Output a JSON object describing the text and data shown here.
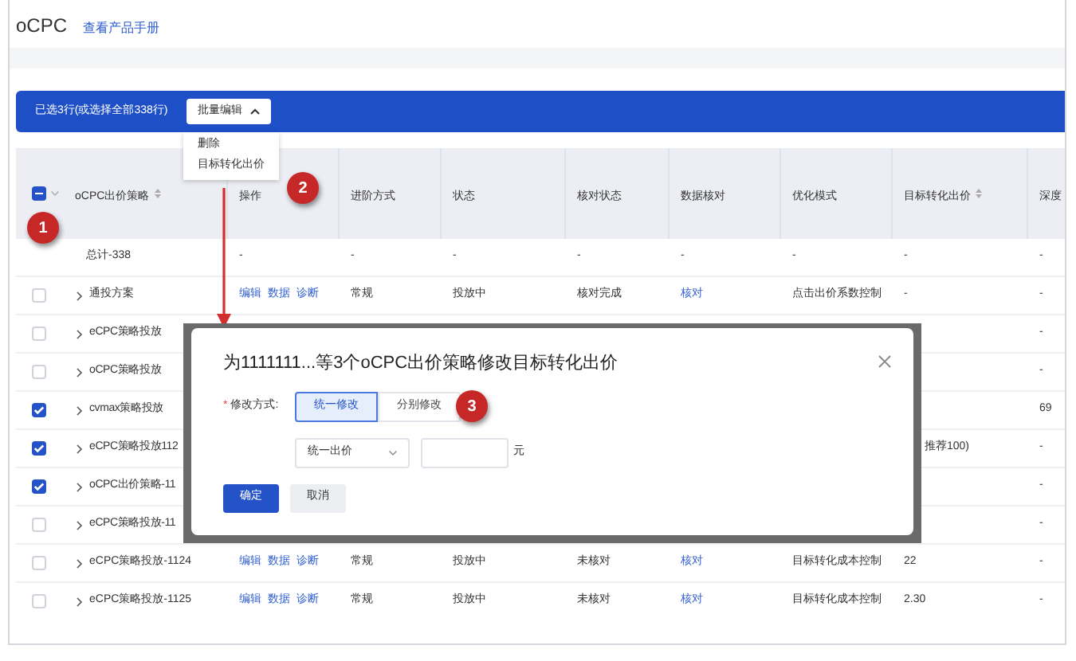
{
  "header": {
    "title": "oCPC",
    "link": "查看产品手册"
  },
  "selection_bar": {
    "text": "已选3行(或选择全部338行)",
    "button": "批量编辑",
    "menu_open": true
  },
  "menu": [
    "删除",
    "目标转化出价"
  ],
  "table": {
    "header_indeterminate": true,
    "columns": [
      "oCPC出价策略",
      "操作",
      "进阶方式",
      "状态",
      "核对状态",
      "数据核对",
      "优化模式",
      "目标转化出价",
      "深度"
    ],
    "rows": [
      {
        "kind": "total",
        "name": "总计-338",
        "cells": [
          "-",
          "-",
          "-",
          "-",
          "-",
          "-",
          "-",
          "-"
        ]
      },
      {
        "kind": "row",
        "name": "通投方案",
        "checked": false,
        "actions": [
          "编辑",
          "数据",
          "诊断"
        ],
        "mode": "常规",
        "status": "投放中",
        "check_status": "核对完成",
        "data_check": "核对",
        "opt_mode": "点击出价系数控制",
        "target": "-",
        "deep": "-"
      },
      {
        "kind": "covered",
        "name": "eCPC策略投放",
        "checked": false,
        "deep": "-"
      },
      {
        "kind": "covered",
        "name": "oCPC策略投放",
        "checked": false,
        "deep": "-"
      },
      {
        "kind": "covered",
        "name": "cvmax策略投放",
        "checked": true,
        "deep": "69"
      },
      {
        "kind": "covered",
        "name": "eCPC策略投放112",
        "checked": true,
        "target": "推荐100)",
        "deep": "-"
      },
      {
        "kind": "covered",
        "name": "oCPC出价策略-11",
        "checked": true,
        "deep": "-"
      },
      {
        "kind": "covered",
        "name": "eCPC策略投放-11",
        "checked": false,
        "deep": "-"
      },
      {
        "kind": "row",
        "name": "eCPC策略投放-1124",
        "checked": false,
        "actions": [
          "编辑",
          "数据",
          "诊断"
        ],
        "mode": "常规",
        "status": "投放中",
        "check_status": "未核对",
        "data_check": "核对",
        "opt_mode": "目标转化成本控制",
        "target": "22",
        "deep": "-"
      },
      {
        "kind": "row",
        "name": "eCPC策略投放-1125",
        "checked": false,
        "actions": [
          "编辑",
          "数据",
          "诊断"
        ],
        "mode": "常规",
        "status": "投放中",
        "check_status": "未核对",
        "data_check": "核对",
        "opt_mode": "目标转化成本控制",
        "target": "2.30",
        "deep": "-"
      }
    ]
  },
  "dialog": {
    "title": "为1111111...等3个oCPC出价策略修改目标转化出价",
    "required_mark": "*",
    "label": "修改方式:",
    "options": [
      {
        "label": "统一修改",
        "selected": true
      },
      {
        "label": "分别修改",
        "selected": false
      }
    ],
    "select": "统一出价",
    "unit": "元",
    "confirm": "确定",
    "cancel": "取消"
  },
  "badges": [
    "1",
    "2",
    "3"
  ]
}
